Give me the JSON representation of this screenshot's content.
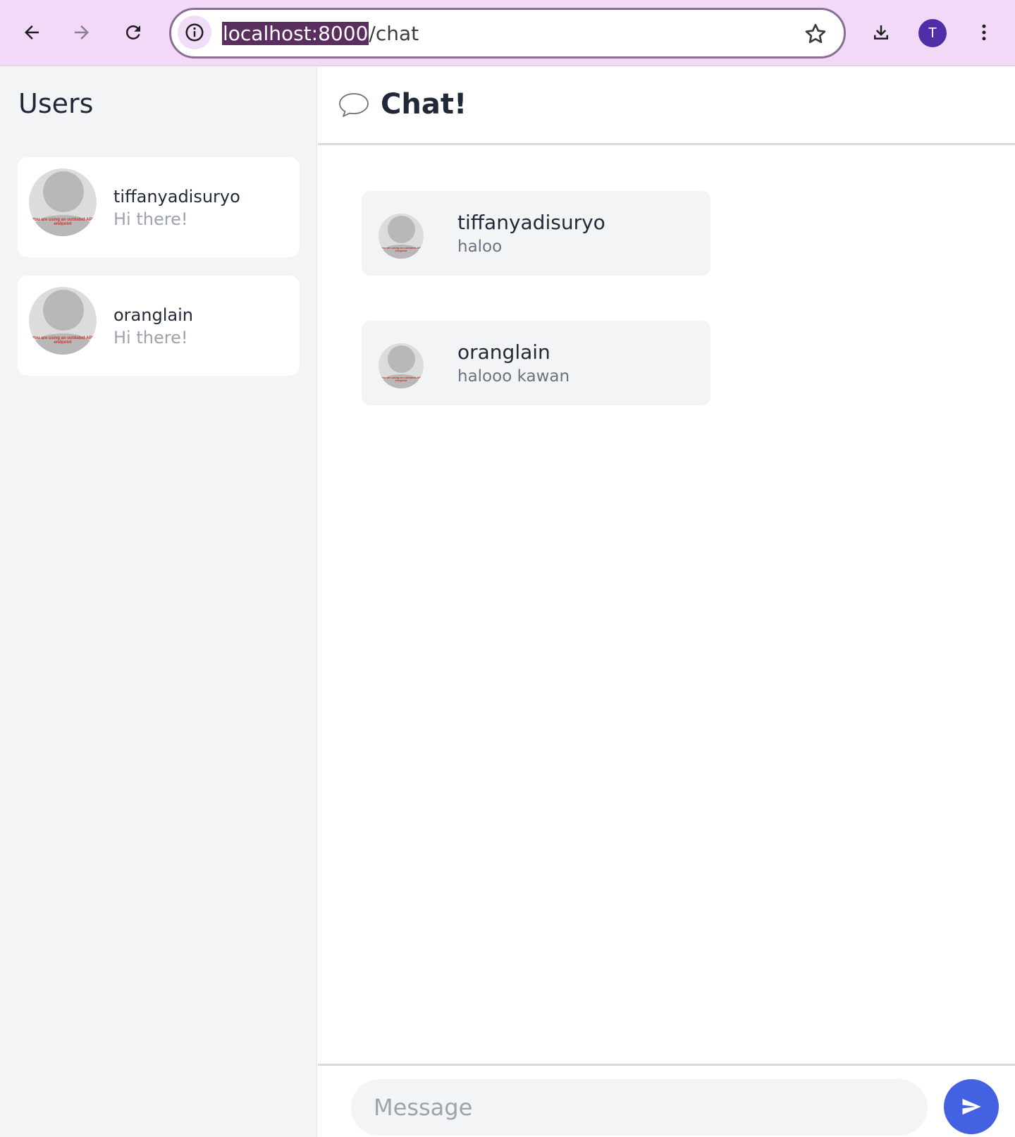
{
  "browser": {
    "url_host": "localhost:8000",
    "url_path": "/chat",
    "profile_initial": "T",
    "icons": [
      "back-arrow-icon",
      "forward-arrow-icon",
      "reload-icon",
      "info-icon",
      "star-icon",
      "download-icon",
      "kebab-menu-icon"
    ]
  },
  "sidebar": {
    "title": "Users",
    "users": [
      {
        "name": "tiffanyadisuryo",
        "preview": "Hi there!",
        "avatar_text": "You are using an outdated API endpoint"
      },
      {
        "name": "oranglain",
        "preview": "Hi there!",
        "avatar_text": "You are using an outdated API endpoint"
      }
    ]
  },
  "chat": {
    "title": "Chat!",
    "messages": [
      {
        "sender": "tiffanyadisuryo",
        "text": "haloo"
      },
      {
        "sender": "oranglain",
        "text": "halooo kawan"
      }
    ],
    "composer": {
      "placeholder": "Message",
      "value": ""
    }
  },
  "colors": {
    "chrome": "#f1d9f7",
    "accent": "#4361e0",
    "profile": "#4f2ea8",
    "sidebar_bg": "#f3f4f6"
  }
}
